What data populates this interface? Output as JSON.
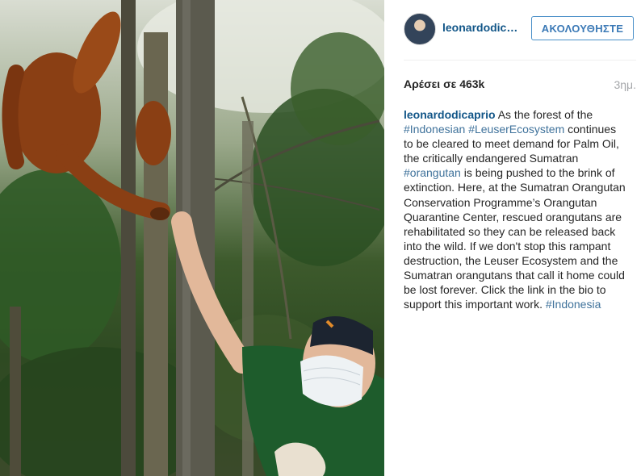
{
  "post": {
    "username": "leonardodicaprio",
    "follow_label": "ΑΚΟΛΟΥΘΗΣΤΕ",
    "likes": "Αρέσει σε 463k",
    "time": "3ημ."
  },
  "caption": {
    "user": "leonardodicaprio",
    "t1": " As the forest of the ",
    "tag1": "#Indonesian",
    "t2": " ",
    "tag2": "#LeuserEcosystem",
    "t3": " continues to be cleared to meet demand for Palm Oil, the critically endangered Sumatran ",
    "tag3": "#orangutan",
    "t4": " is being pushed to the brink of extinction. Here, at the Sumatran Orangutan Conservation Programme’s Orangutan Quarantine Center, rescued orangutans are rehabilitated so they can be released back into the wild. If we don't stop this rampant destruction, the Leuser Ecosystem and the Sumatran orangutans that call it home could be lost forever. Click the link in the bio to support this important work. ",
    "tag4": "#Indonesia"
  },
  "colors": {
    "link": "#125688",
    "hashtag": "#3f729b",
    "follow_border": "#4a90c8",
    "muted": "#a5a7aa"
  }
}
